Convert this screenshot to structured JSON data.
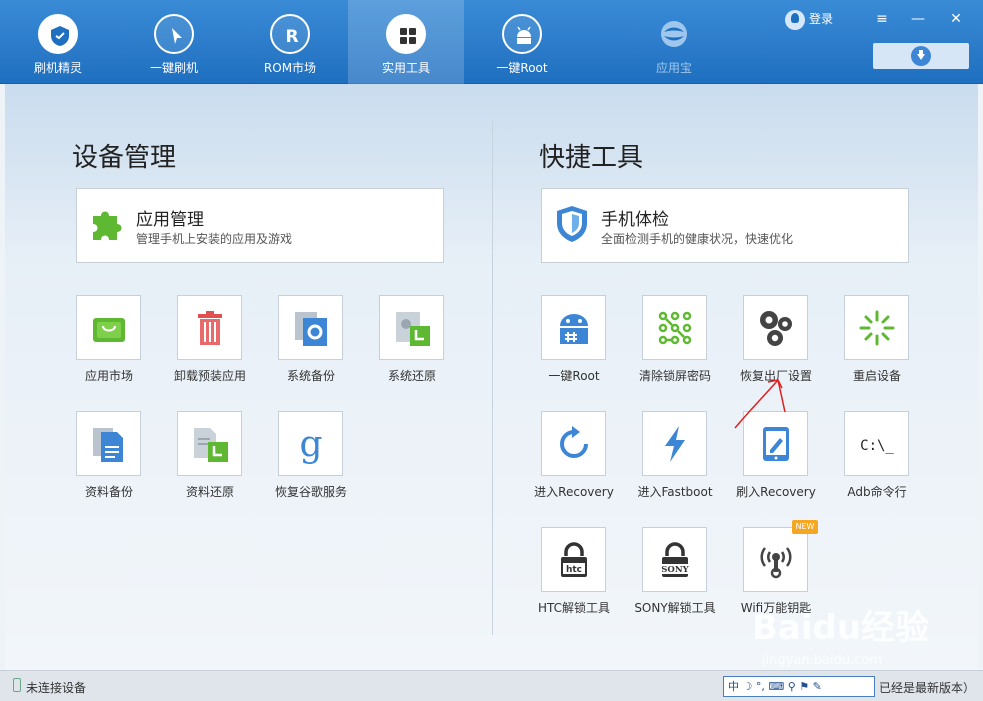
{
  "nav": [
    {
      "label": "刷机精灵",
      "icon": "shield-logo-icon"
    },
    {
      "label": "一键刷机",
      "icon": "cursor-icon"
    },
    {
      "label": "ROM市场",
      "icon": "r-icon"
    },
    {
      "label": "实用工具",
      "icon": "grid-icon"
    },
    {
      "label": "一键Root",
      "icon": "android-icon"
    },
    {
      "label": "应用宝",
      "icon": "yingyongbao-icon"
    }
  ],
  "header": {
    "login": "登录",
    "menu": "≡",
    "minimize": "—",
    "close": "✕"
  },
  "device": {
    "title": "设备管理",
    "card": {
      "title": "应用管理",
      "sub": "管理手机上安装的应用及游戏"
    },
    "tiles": [
      {
        "label": "应用市场",
        "icon": "shopping-bag-icon"
      },
      {
        "label": "卸载预装应用",
        "icon": "trash-icon"
      },
      {
        "label": "系统备份",
        "icon": "system-backup-icon"
      },
      {
        "label": "系统还原",
        "icon": "system-restore-icon"
      },
      {
        "label": "资料备份",
        "icon": "document-backup-icon"
      },
      {
        "label": "资料还原",
        "icon": "document-restore-icon"
      },
      {
        "label": "恢复谷歌服务",
        "icon": "google-g-icon"
      }
    ]
  },
  "tools": {
    "title": "快捷工具",
    "card": {
      "title": "手机体检",
      "sub": "全面检测手机的健康状况，快速优化"
    },
    "tiles": [
      {
        "label": "一键Root",
        "icon": "android-root-icon"
      },
      {
        "label": "清除锁屏密码",
        "icon": "pattern-lock-icon"
      },
      {
        "label": "恢复出厂设置",
        "icon": "gears-icon"
      },
      {
        "label": "重启设备",
        "icon": "spinner-icon"
      },
      {
        "label": "进入Recovery",
        "icon": "refresh-icon"
      },
      {
        "label": "进入Fastboot",
        "icon": "lightning-icon"
      },
      {
        "label": "刷入Recovery",
        "icon": "tablet-edit-icon"
      },
      {
        "label": "Adb命令行",
        "icon": "terminal-icon",
        "text": "C:\\_"
      },
      {
        "label": "HTC解锁工具",
        "icon": "htc-lock-icon",
        "brand": "htc"
      },
      {
        "label": "SONY解锁工具",
        "icon": "sony-lock-icon",
        "brand": "SONY"
      },
      {
        "label": "Wifi万能钥匙",
        "icon": "wifi-key-icon",
        "badge": "NEW"
      }
    ]
  },
  "status": {
    "device": "未连接设备",
    "version": "已经是最新版本）",
    "ime": "中 ☽ °, ⌨ ⚲ ⚑ ✎"
  },
  "watermark": {
    "brand": "Baidu经验",
    "url": "jingyan.baidu.com"
  },
  "colors": {
    "accent": "#1f6fc0",
    "green": "#5fb832",
    "red": "#e05050",
    "blue": "#3d86d6"
  }
}
